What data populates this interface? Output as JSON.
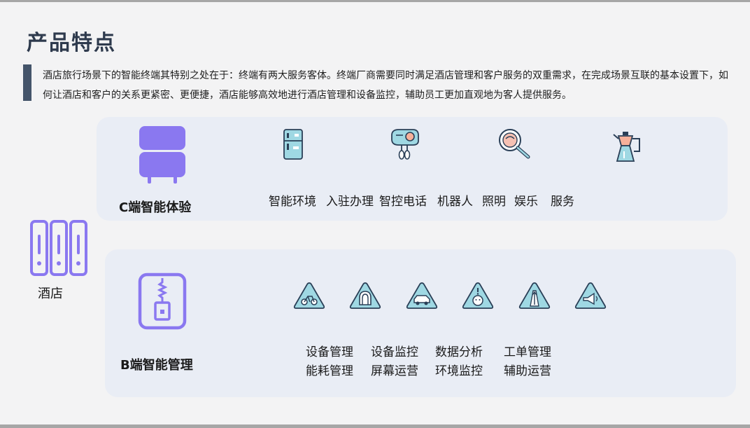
{
  "page": {
    "title": "产品特点",
    "intro": "酒店旅行场景下的智能终端其特别之处在于：终端有两大服务客体。终端厂商需要同时满足酒店管理和客户服务的双重需求，在完成场景互联的基本设置下，如何让酒店和客户的关系更紧密、更便捷，酒店能够高效地进行酒店管理和设备监控，辅助员工更加直观地为客人提供服务。"
  },
  "hotel": {
    "label": "酒店",
    "icon": "server-rack-icon"
  },
  "c_panel": {
    "label": "C端智能体验",
    "icon": "fridge-icon",
    "feature_icons": [
      "refrigerator-icon",
      "hand-mixer-icon",
      "magnifier-icon",
      "coffee-pot-icon"
    ],
    "features": [
      "智能环境",
      "入驻办理",
      "智控电话",
      "机器人",
      "照明",
      "娱乐",
      "服务"
    ]
  },
  "b_panel": {
    "label": "B端智能管理",
    "icon": "mobile-device-icon",
    "warning_icons": [
      "bicycle-sign-icon",
      "tunnel-sign-icon",
      "car-sign-icon",
      "child-sign-icon",
      "road-sign-icon",
      "megaphone-sign-icon"
    ],
    "items_row1": [
      "设备管理",
      "设备监控",
      "数据分析",
      "工单管理"
    ],
    "items_row2": [
      "能耗管理",
      "屏幕运营",
      "环境监控",
      "辅助运营"
    ]
  },
  "colors": {
    "accent": "#8a78f0",
    "title": "#2e3a4d",
    "panel": "#e9edf5",
    "intro_bar": "#44546a"
  }
}
